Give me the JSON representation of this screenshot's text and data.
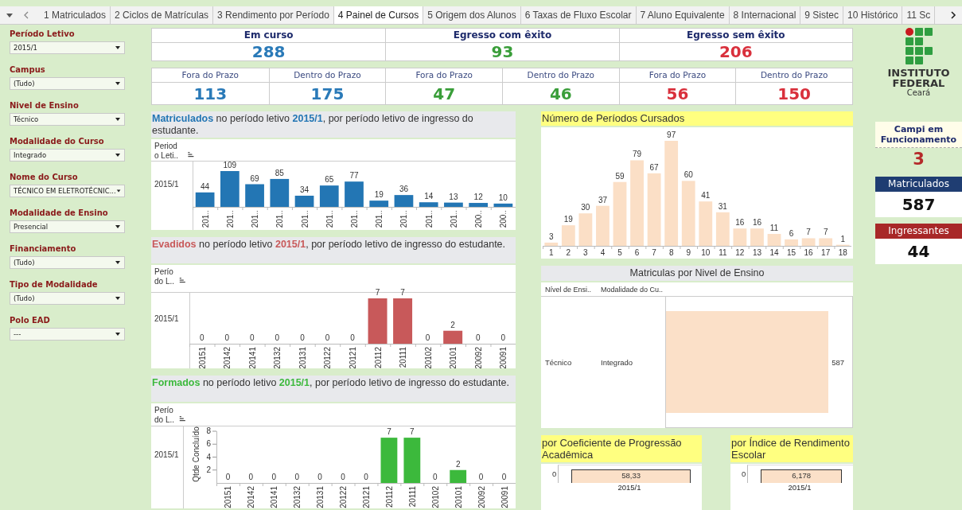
{
  "tabs": [
    {
      "label": "1 Matriculados",
      "selected": false
    },
    {
      "label": "2 Ciclos de Matrículas",
      "selected": false
    },
    {
      "label": "3 Rendimento por Período",
      "selected": false
    },
    {
      "label": "4 Painel de Cursos",
      "selected": true
    },
    {
      "label": "5 Origem dos Alunos",
      "selected": false
    },
    {
      "label": "6 Taxas de Fluxo Escolar",
      "selected": false
    },
    {
      "label": "7 Aluno Equivalente",
      "selected": false
    },
    {
      "label": "8 Internacional",
      "selected": false
    },
    {
      "label": "9 Sistec",
      "selected": false
    },
    {
      "label": "10 Histórico",
      "selected": false
    },
    {
      "label": "11 Sc",
      "selected": false
    }
  ],
  "filters": [
    {
      "label": "Período Letivo",
      "value": "2015/1"
    },
    {
      "label": "Campus",
      "value": "(Tudo)"
    },
    {
      "label": "Nivel de Ensino",
      "value": "Técnico"
    },
    {
      "label": "Modalidade do Curso",
      "value": "Integrado"
    },
    {
      "label": "Nome do Curso",
      "value": "TÉCNICO EM ELETROTÉCNIC..."
    },
    {
      "label": "Modalidade de Ensino",
      "value": "Presencial"
    },
    {
      "label": "Financiamento",
      "value": "(Tudo)"
    },
    {
      "label": "Tipo de Modalidade",
      "value": "(Tudo)"
    },
    {
      "label": "Polo EAD",
      "value": "---"
    }
  ],
  "summary": [
    {
      "label": "Em curso",
      "value": "288",
      "color": "#2a7ab8"
    },
    {
      "label": "Egresso com êxito",
      "value": "93",
      "color": "#3a9e3a"
    },
    {
      "label": "Egresso sem êxito",
      "value": "206",
      "color": "#d9303c"
    }
  ],
  "breakdown": [
    {
      "label": "Fora do Prazo",
      "value": "113",
      "color": "#2a7ab8"
    },
    {
      "label": "Dentro do Prazo",
      "value": "175",
      "color": "#2a7ab8"
    },
    {
      "label": "Fora do Prazo",
      "value": "47",
      "color": "#3a9e3a"
    },
    {
      "label": "Dentro do Prazo",
      "value": "46",
      "color": "#3a9e3a"
    },
    {
      "label": "Fora do Prazo",
      "value": "56",
      "color": "#d9303c"
    },
    {
      "label": "Dentro do Prazo",
      "value": "150",
      "color": "#d9303c"
    }
  ],
  "left_charts": [
    {
      "title": "**Matriculados** no período letivo **2015/1**, por período letivo de ingresso do estudante.",
      "header_lines": [
        "Period",
        "o Leti.."
      ],
      "row_label": "2015/1",
      "chart_data": {
        "type": "bar",
        "categories": [
          "201..",
          "201..",
          "201..",
          "201..",
          "201..",
          "201..",
          "201..",
          "201..",
          "201..",
          "201..",
          "201..",
          "200..",
          "200.."
        ],
        "data_labels": true,
        "series": [
          {
            "color": "#2376b4",
            "values": [
              44,
              109,
              69,
              85,
              34,
              65,
              77,
              19,
              36,
              14,
              13,
              12,
              10
            ]
          }
        ]
      }
    },
    {
      "title": "**Evadidos** no período letivo **2015/1**, por período letivo de ingresso do estudante.",
      "header_lines": [
        "Perío",
        "do L.."
      ],
      "row_label": "2015/1",
      "chart_data": {
        "type": "bar",
        "categories": [
          "20151",
          "20142",
          "20141",
          "20132",
          "20131",
          "20122",
          "20121",
          "20112",
          "20111",
          "20102",
          "20101",
          "20092",
          "20091"
        ],
        "data_labels": true,
        "series": [
          {
            "color": "#c8595a",
            "values": [
              0,
              0,
              0,
              0,
              0,
              0,
              0,
              7,
              7,
              0,
              2,
              0,
              0
            ]
          }
        ]
      }
    },
    {
      "title": "**Formados** no período letivo **2015/1**, por período letivo de ingresso do estudante.",
      "header_lines": [
        "Perío",
        "do L.."
      ],
      "row_label": "2015/1",
      "chart_data": {
        "type": "bar",
        "categories": [
          "20151",
          "20142",
          "20141",
          "20132",
          "20131",
          "20122",
          "20121",
          "20112",
          "20111",
          "20102",
          "20101",
          "20092",
          "20091"
        ],
        "data_labels": true,
        "ylabel": "Qtde Concluído",
        "yticks": [
          2,
          4,
          6,
          8
        ],
        "ylim": [
          0,
          8
        ],
        "series": [
          {
            "color": "#3cb93c",
            "values": [
              0,
              0,
              0,
              0,
              0,
              0,
              0,
              7,
              7,
              0,
              2,
              0,
              0
            ]
          }
        ]
      }
    }
  ],
  "periods_chart": {
    "title": "Número de Períodos Cursados",
    "chart_data": {
      "type": "bar",
      "categories": [
        "1",
        "2",
        "3",
        "4",
        "5",
        "6",
        "7",
        "8",
        "9",
        "10",
        "11",
        "12",
        "13",
        "14",
        "15",
        "16",
        "17",
        "18"
      ],
      "data_labels": true,
      "series": [
        {
          "color": "#fbdfc6",
          "values": [
            3,
            19,
            30,
            37,
            59,
            79,
            67,
            97,
            60,
            41,
            31,
            16,
            16,
            11,
            6,
            7,
            7,
            1
          ]
        }
      ]
    }
  },
  "level_table": {
    "title": "Matriculas por Nivel de Ensino",
    "columns": [
      "Nível de Ensi..",
      "Modalidade do Cu.."
    ],
    "rows": [
      {
        "cells": [
          "Técnico",
          "Integrado"
        ],
        "value": "587"
      }
    ]
  },
  "small_charts": [
    {
      "title": "por Coeficiente de Progressão Acadêmica",
      "ytick": "0",
      "bar_label": "58,33",
      "category": "2015/1"
    },
    {
      "title": "por Índice de Rendimento Escolar",
      "ytick": "0",
      "bar_label": "6,178",
      "category": "2015/1"
    }
  ],
  "logo": {
    "lines": [
      "INSTITUTO",
      "FEDERAL"
    ],
    "subtitle": "Ceará"
  },
  "stats": [
    {
      "kind": "plain",
      "label": "Campi em Funcionamento",
      "value": "3",
      "color": "#b52a2a"
    },
    {
      "kind": "header",
      "label": "Matriculados",
      "value": "587",
      "color": "#1f3d72"
    },
    {
      "kind": "header",
      "label": "Ingressantes",
      "value": "44",
      "color": "#a82828"
    }
  ]
}
